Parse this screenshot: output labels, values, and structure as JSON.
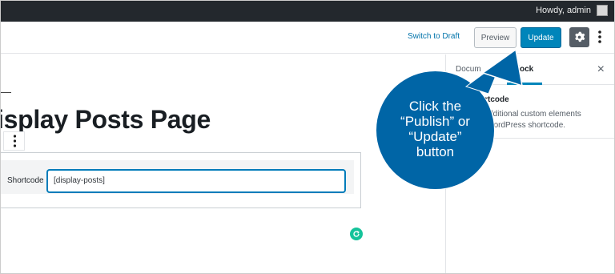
{
  "admin_bar": {
    "greeting": "Howdy, admin"
  },
  "header": {
    "switch_to_draft": "Switch to Draft",
    "preview": "Preview",
    "update": "Update",
    "settings_icon": "gear-icon",
    "more_icon": "vertical-ellipsis-icon"
  },
  "editor": {
    "title": "isplay Posts Page",
    "shortcode_block": {
      "label": "Shortcode",
      "value": "[display-posts]"
    }
  },
  "sidebar": {
    "tabs": [
      {
        "label": "Docum"
      },
      {
        "label": "Block"
      }
    ],
    "close": "×",
    "block_card": {
      "title": "ortcode",
      "description": "t additional custom elements\na WordPress shortcode."
    }
  },
  "callout": {
    "text": "Click the\n“Publish” or\n“Update”\nbutton"
  },
  "colors": {
    "accent": "#0085ba",
    "callout": "#0065a6",
    "admin_bar": "#23282d"
  }
}
